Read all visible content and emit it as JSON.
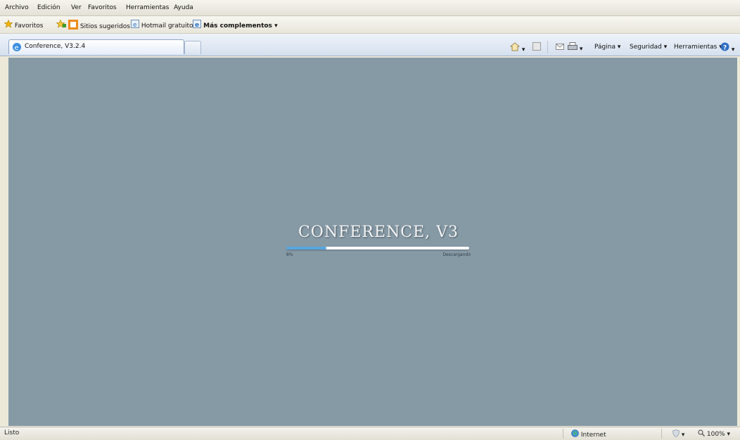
{
  "menu": [
    "Archivo",
    "Edición",
    "Ver",
    "Favoritos",
    "Herramientas",
    "Ayuda"
  ],
  "favorites_bar": {
    "favorites_label": "Favoritos",
    "links": [
      {
        "label": "Sitios sugeridos",
        "icon": "suggested-sites-icon",
        "dropdown": true
      },
      {
        "label": "Hotmail gratuito",
        "icon": "ie-page-icon",
        "dropdown": false
      },
      {
        "label": "Más complementos",
        "icon": "ie-page-icon",
        "dropdown": true
      }
    ]
  },
  "tab": {
    "title": "Conference, V3.2.4",
    "icon": "ie-logo-icon"
  },
  "command_bar": {
    "page_label": "Página",
    "security_label": "Seguridad",
    "tools_label": "Herramientas"
  },
  "app": {
    "title": "CONFERENCE, V3",
    "progress_fraction": 0.22,
    "progress_percent_text": "8%",
    "progress_status_text": "Descargando"
  },
  "status_bar": {
    "status_text": "Listo",
    "zone_text": "Internet",
    "zoom_text": "100%"
  },
  "colors": {
    "viewport_bg": "#869aa6",
    "progress_fill": "#58a7df",
    "progress_track": "#ffffff"
  }
}
